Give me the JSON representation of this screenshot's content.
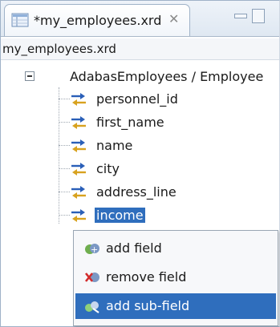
{
  "editor_tab": {
    "title": "*my_employees.xrd",
    "close_glyph": "✕"
  },
  "path_header": "my_employees.xrd",
  "tree": {
    "root_label": "AdabasEmployees / Employee",
    "fields": [
      {
        "label": "personnel_id",
        "selected": false
      },
      {
        "label": "first_name",
        "selected": false
      },
      {
        "label": "name",
        "selected": false
      },
      {
        "label": "city",
        "selected": false
      },
      {
        "label": "address_line",
        "selected": false
      },
      {
        "label": "income",
        "selected": true
      }
    ]
  },
  "context_menu": {
    "items": [
      {
        "label": "add field",
        "icon": "add-field-icon",
        "active": false
      },
      {
        "label": "remove field",
        "icon": "remove-field-icon",
        "active": false
      },
      {
        "label": "add sub-field",
        "icon": "add-subfield-icon",
        "active": true
      }
    ]
  },
  "colors": {
    "selection": "#2f6ebd",
    "field_arrow_blue": "#2a5fb8",
    "field_arrow_gold": "#d8a21f"
  }
}
